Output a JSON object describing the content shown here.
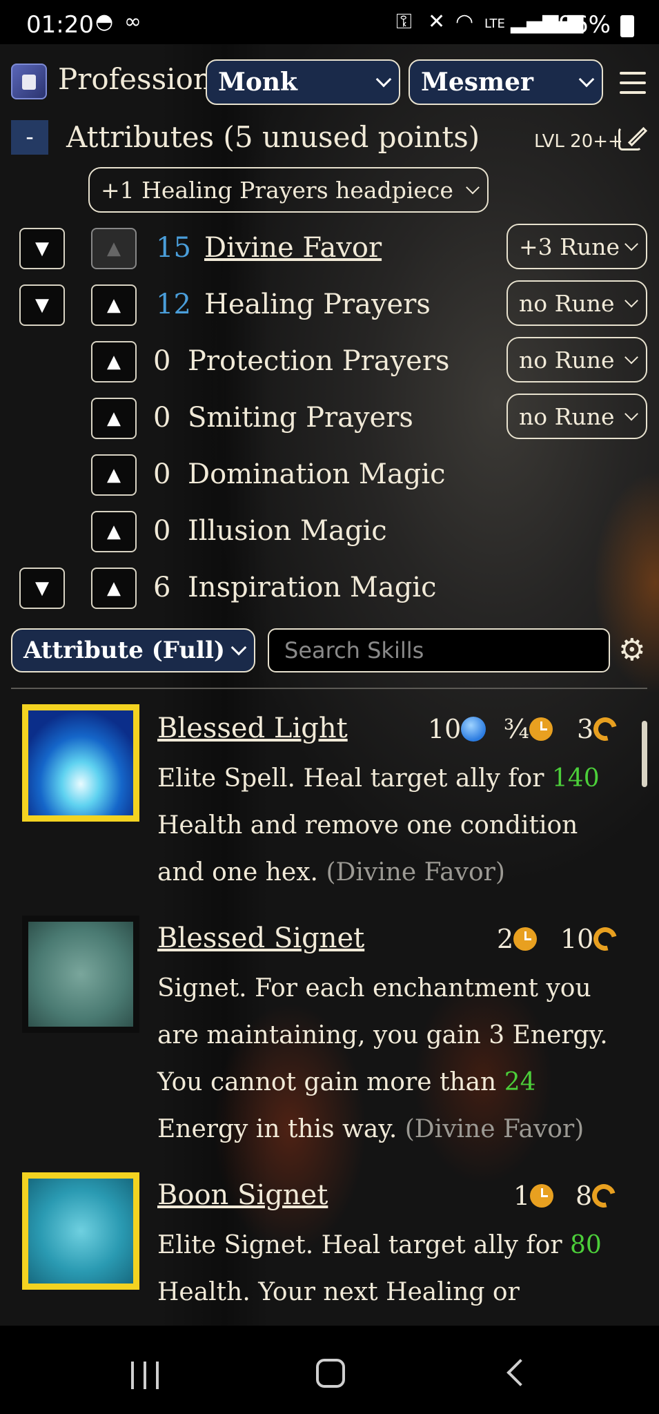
{
  "status_bar": {
    "time": "01:20",
    "battery": "96%"
  },
  "header": {
    "profession_label": "Profession",
    "primary_profession": "Monk",
    "secondary_profession": "Mesmer"
  },
  "attributes": {
    "collapse_label": "-",
    "title": "Attributes (5 unused points)",
    "level_label": "LVL 20++",
    "headpiece": "+1 Healing Prayers headpiece",
    "items": [
      {
        "value": "15",
        "name": "Divine Favor",
        "rune": "+3 Rune"
      },
      {
        "value": "12",
        "name": "Healing Prayers",
        "rune": "no Rune"
      },
      {
        "value": "0",
        "name": "Protection Prayers",
        "rune": "no Rune"
      },
      {
        "value": "0",
        "name": "Smiting Prayers",
        "rune": "no Rune"
      },
      {
        "value": "0",
        "name": "Domination Magic"
      },
      {
        "value": "0",
        "name": "Illusion Magic"
      },
      {
        "value": "6",
        "name": "Inspiration Magic"
      }
    ],
    "down_glyph": "▼",
    "up_glyph": "▲"
  },
  "skills_toolbar": {
    "sort_value": "Attribute (Full)",
    "search_placeholder": "Search Skills"
  },
  "skills": [
    {
      "name": "Blessed Light",
      "energy": "10",
      "cast": "¾",
      "recharge": "3",
      "desc_a": "Elite Spell. Heal target ally for ",
      "desc_g": "140",
      "desc_b": " Health and remove one condition and one hex. ",
      "attribute": "(Divine Favor)"
    },
    {
      "name": "Blessed Signet",
      "cast": "2",
      "recharge": "10",
      "desc_a": "Signet. For each enchantment you are maintaining, you gain 3 Energy. You cannot gain more than ",
      "desc_g": "24",
      "desc_b": " Energy in this way. ",
      "attribute": "(Divine Favor)"
    },
    {
      "name": "Boon Signet",
      "cast": "1",
      "recharge": "8",
      "desc_a": "Elite Signet. Heal target ally for ",
      "desc_g": "80",
      "desc_b": " Health. Your next Healing or"
    }
  ]
}
